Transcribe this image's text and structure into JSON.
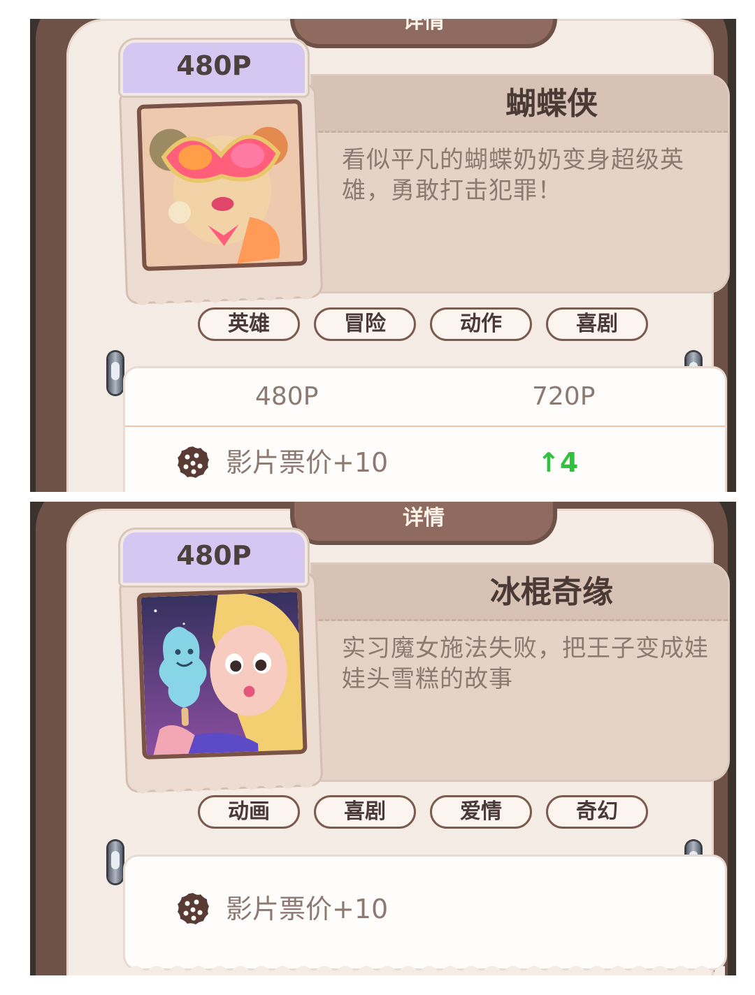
{
  "cards": [
    {
      "header_title": "详情",
      "price_tag": "480P",
      "title": "蝴蝶侠",
      "description": "看似平凡的蝴蝶奶奶变身超级英雄，勇敢打击犯罪！",
      "tags": [
        "英雄",
        "冒险",
        "动作",
        "喜剧"
      ],
      "stats_header": {
        "current": "480P",
        "next": "720P"
      },
      "stat": {
        "icon": "cookie-icon",
        "label": "影片票价+10",
        "change": "↑4"
      },
      "poster_icon": "butterfly-grandma-poster",
      "colors": {
        "accent_purple": "#d5c6f2",
        "up_green": "#31c13f",
        "frame_brown": "#6e5147"
      }
    },
    {
      "header_title": "详情",
      "price_tag": "480P",
      "title": "冰棍奇缘",
      "description": "实习魔女施法失败，把王子变成娃娃头雪糕的故事",
      "tags": [
        "动画",
        "喜剧",
        "爱情",
        "奇幻"
      ],
      "stat": {
        "icon": "cookie-icon",
        "label": "影片票价+10"
      },
      "poster_icon": "popsicle-romance-poster",
      "colors": {
        "accent_purple": "#d5c6f2",
        "frame_brown": "#6e5147"
      }
    }
  ]
}
